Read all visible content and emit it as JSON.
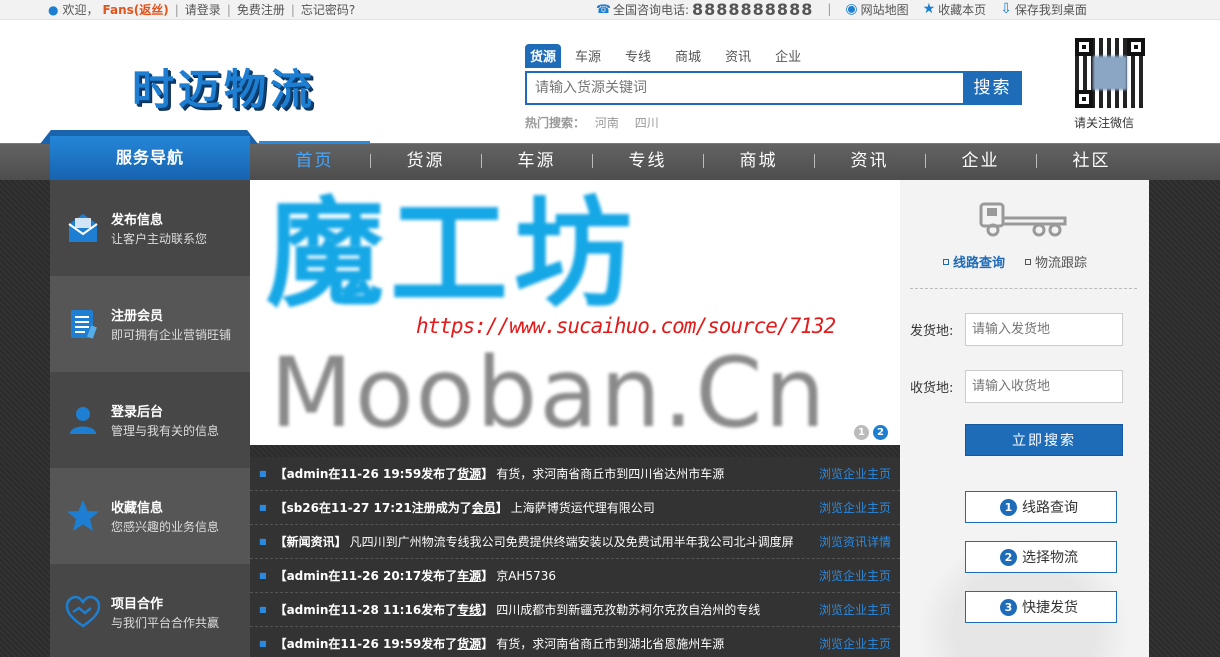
{
  "topbar": {
    "welcome": "欢迎，",
    "fans": "Fans(返丝)",
    "login": "请登录",
    "register": "免费注册",
    "forgot": "忘记密码?",
    "phone_label": "全国咨询电话:",
    "phone": "8888888888",
    "sitemap": "网站地图",
    "favorite": "收藏本页",
    "save_desktop": "保存我到桌面",
    "separator": "|"
  },
  "header": {
    "logo": "时迈物流",
    "search_tabs": [
      "货源",
      "车源",
      "专线",
      "商城",
      "资讯",
      "企业"
    ],
    "search_placeholder": "请输入货源关键词",
    "search_button": "搜索",
    "hot_label": "热门搜索：",
    "hot_items": [
      "河南",
      "四川"
    ],
    "qr_label": "请关注微信"
  },
  "nav": {
    "service": "服务导航",
    "items": [
      "首页",
      "货源",
      "车源",
      "专线",
      "商城",
      "资讯",
      "企业",
      "社区"
    ]
  },
  "sidebar": {
    "items": [
      {
        "title": "发布信息",
        "sub": "让客户主动联系您",
        "icon": "mail-icon"
      },
      {
        "title": "注册会员",
        "sub": "即可拥有企业营销旺铺",
        "icon": "document-icon"
      },
      {
        "title": "登录后台",
        "sub": "管理与我有关的信息",
        "icon": "user-icon"
      },
      {
        "title": "收藏信息",
        "sub": "您感兴趣的业务信息",
        "icon": "star-icon"
      },
      {
        "title": "项目合作",
        "sub": "与我们平台合作共赢",
        "icon": "handshake-icon"
      }
    ]
  },
  "banner": {
    "line1": "魔工坊",
    "line2": "Mooban.Cn",
    "url": "https://www.sucaihuo.com/source/7132",
    "dots": [
      "1",
      "2"
    ]
  },
  "news": [
    {
      "pre": "【admin在11-26 19:59发布了",
      "link": "货源",
      "post": "】",
      "text": "有货，求河南省商丘市到四川省达州市车源",
      "more": "浏览企业主页"
    },
    {
      "pre": "【sb26在11-27 17:21注册成为了",
      "link": "会员",
      "post": "】",
      "text": "上海萨博货运代理有限公司",
      "more": "浏览企业主页"
    },
    {
      "pre": "【新闻资讯】",
      "link": "",
      "post": "",
      "text": "凡四川到广州物流专线我公司免费提供终端安装以及免费试用半年我公司北斗调度屏",
      "more": "浏览资讯详情"
    },
    {
      "pre": "【admin在11-26 20:17发布了",
      "link": "车源",
      "post": "】",
      "text": "京AH5736",
      "more": "浏览企业主页"
    },
    {
      "pre": "【admin在11-28 11:16发布了",
      "link": "专线",
      "post": "】",
      "text": "四川成都市到新疆克孜勒苏柯尔克孜自治州的专线",
      "more": "浏览企业主页"
    },
    {
      "pre": "【admin在11-26 19:59发布了",
      "link": "货源",
      "post": "】",
      "text": "有货，求河南省商丘市到湖北省恩施州车源",
      "more": "浏览企业主页"
    }
  ],
  "right": {
    "tabs": [
      "线路查询",
      "物流跟踪"
    ],
    "from_label": "发货地:",
    "from_placeholder": "请输入发货地",
    "to_label": "收货地:",
    "to_placeholder": "请输入收货地",
    "search_button": "立即搜索",
    "steps": [
      {
        "num": "1",
        "label": "线路查询"
      },
      {
        "num": "2",
        "label": "选择物流"
      },
      {
        "num": "3",
        "label": "快捷发货"
      }
    ]
  }
}
